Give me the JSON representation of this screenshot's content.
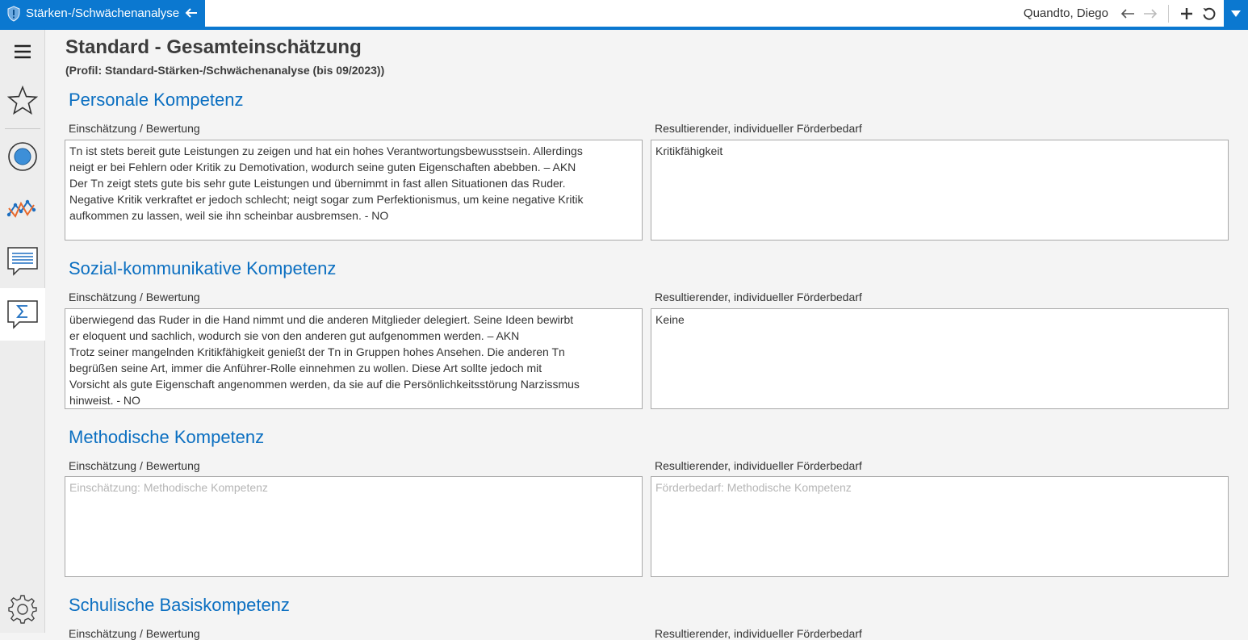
{
  "tab": {
    "title": "Stärken-/Schwächenanalyse"
  },
  "header": {
    "user": "Quandto, Diego"
  },
  "page": {
    "title": "Standard - Gesamteinschätzung",
    "subtitle": "(Profil: Standard-Stärken-/Schwächenanalyse (bis 09/2023))"
  },
  "sections": [
    {
      "title": "Personale Kompetenz",
      "left_label": "Einschätzung / Bewertung",
      "right_label": "Resultierender, individueller Förderbedarf",
      "left_value": "Tn ist stets bereit gute Leistungen zu zeigen und hat ein hohes Verantwortungsbewusstsein. Allerdings\nneigt er bei Fehlern oder Kritik zu Demotivation, wodurch seine guten Eigenschaften abebben. – AKN\nDer Tn zeigt stets gute bis sehr gute Leistungen und übernimmt in fast allen Situationen das Ruder.\nNegative Kritik verkraftet er jedoch schlecht; neigt sogar zum Perfektionismus, um keine negative Kritik\naufkommen zu lassen, weil sie ihn scheinbar ausbremsen. - NO",
      "right_value": "Kritikfähigkeit"
    },
    {
      "title": "Sozial-kommunikative Kompetenz",
      "left_label": "Einschätzung / Bewertung",
      "right_label": "Resultierender, individueller Förderbedarf",
      "left_value": "überwiegend das Ruder in die Hand nimmt und die anderen Mitglieder delegiert. Seine Ideen bewirbt\ner eloquent und sachlich, wodurch sie von den anderen gut aufgenommen werden. – AKN\nTrotz seiner mangelnden Kritikfähigkeit genießt der Tn in Gruppen hohes Ansehen. Die anderen Tn\nbegrüßen seine Art, immer die Anführer-Rolle einnehmen zu wollen. Diese Art sollte jedoch mit\nVorsicht als gute Eigenschaft angenommen werden, da sie auf die Persönlichkeitsstörung Narzissmus\nhinweist. - NO",
      "right_value": "Keine"
    },
    {
      "title": "Methodische Kompetenz",
      "left_label": "Einschätzung / Bewertung",
      "right_label": "Resultierender, individueller Förderbedarf",
      "left_placeholder": "Einschätzung: Methodische Kompetenz",
      "right_placeholder": "Förderbedarf: Methodische Kompetenz"
    },
    {
      "title": "Schulische Basiskompetenz",
      "left_label": "Einschätzung / Bewertung",
      "right_label": "Resultierender, individueller Förderbedarf"
    }
  ],
  "icons": {
    "tab": [
      "shield-icon",
      "back-arrow-icon"
    ],
    "toolbar": [
      "history-back-icon",
      "history-forward-icon",
      "add-icon",
      "refresh-icon",
      "dropdown-icon"
    ],
    "sidebar": [
      "menu-icon",
      "star-icon",
      "target-icon",
      "chart-icon",
      "comment-icon",
      "sum-icon",
      "settings-icon"
    ]
  },
  "colors": {
    "accent": "#0b78d0",
    "section_title": "#0b6fc1"
  }
}
